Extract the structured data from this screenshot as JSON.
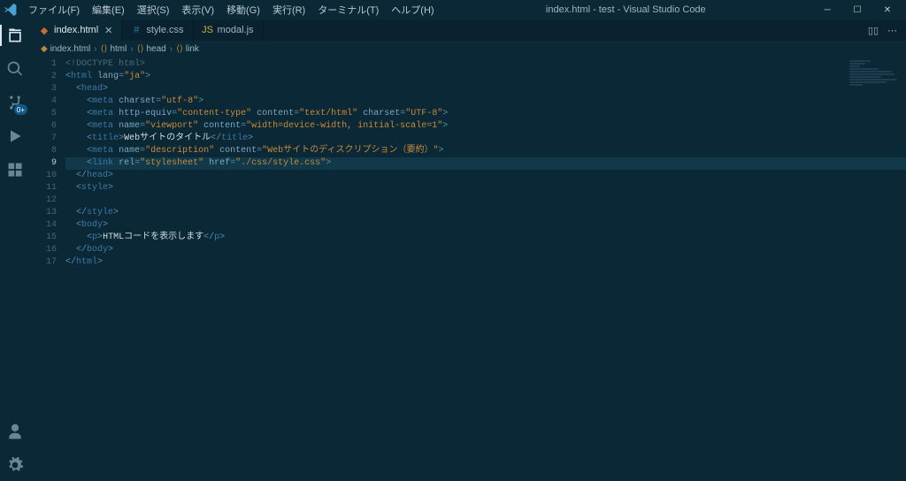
{
  "window": {
    "title": "index.html - test - Visual Studio Code"
  },
  "menu": {
    "items": [
      "ファイル(F)",
      "編集(E)",
      "選択(S)",
      "表示(V)",
      "移動(G)",
      "実行(R)",
      "ターミナル(T)",
      "ヘルプ(H)"
    ]
  },
  "winControls": {
    "min": "─",
    "max": "☐",
    "close": "✕"
  },
  "activity": {
    "badge_scm": "0+"
  },
  "tabs": [
    {
      "label": "index.html",
      "icon": "html-file-icon",
      "active": true,
      "dirty": false
    },
    {
      "label": "style.css",
      "icon": "css-file-icon",
      "active": false,
      "dirty": false
    },
    {
      "label": "modal.js",
      "icon": "js-file-icon",
      "active": false,
      "dirty": false
    }
  ],
  "tabActions": {
    "split": "▯▯",
    "more": "⋯"
  },
  "breadcrumbs": [
    {
      "icon": "html-file-icon",
      "label": "index.html"
    },
    {
      "icon": "tag-icon",
      "label": "html"
    },
    {
      "icon": "tag-icon",
      "label": "head"
    },
    {
      "icon": "tag-icon",
      "label": "link"
    }
  ],
  "code": {
    "lineCount": 17,
    "currentLine": 9,
    "lines": [
      {
        "n": 1,
        "html": "<span class='t-comment'>&lt;!DOCTYPE html&gt;</span>"
      },
      {
        "n": 2,
        "html": "<span class='t-punct'>&lt;</span><span class='t-tag'>html</span> <span class='t-attr'>lang</span><span class='t-punct'>=</span><span class='t-string'>\"ja\"</span><span class='t-punct'>&gt;</span>"
      },
      {
        "n": 3,
        "html": "  <span class='t-punct'>&lt;</span><span class='t-tag'>head</span><span class='t-punct'>&gt;</span>"
      },
      {
        "n": 4,
        "html": "    <span class='t-punct'>&lt;</span><span class='t-tag'>meta</span> <span class='t-attr'>charset</span><span class='t-punct'>=</span><span class='t-string'>\"utf-8\"</span><span class='t-punct'>&gt;</span>"
      },
      {
        "n": 5,
        "html": "    <span class='t-punct'>&lt;</span><span class='t-tag'>meta</span> <span class='t-attr'>http-equiv</span><span class='t-punct'>=</span><span class='t-string'>\"content-type\"</span> <span class='t-attr'>content</span><span class='t-punct'>=</span><span class='t-string'>\"text/html\"</span> <span class='t-attr'>charset</span><span class='t-punct'>=</span><span class='t-string'>\"UTF-8\"</span><span class='t-punct'>&gt;</span>"
      },
      {
        "n": 6,
        "html": "    <span class='t-punct'>&lt;</span><span class='t-tag'>meta</span> <span class='t-attr'>name</span><span class='t-punct'>=</span><span class='t-string'>\"viewport\"</span> <span class='t-attr'>content</span><span class='t-punct'>=</span><span class='t-string'>\"width=device-width, initial-scale=1\"</span><span class='t-punct'>&gt;</span>"
      },
      {
        "n": 7,
        "html": "    <span class='t-punct'>&lt;</span><span class='t-tag'>title</span><span class='t-punct'>&gt;</span><span class='t-text'>Webサイトのタイトル</span><span class='t-punct'>&lt;/</span><span class='t-tag'>title</span><span class='t-punct'>&gt;</span>"
      },
      {
        "n": 8,
        "html": "    <span class='t-punct'>&lt;</span><span class='t-tag'>meta</span> <span class='t-attr'>name</span><span class='t-punct'>=</span><span class='t-string'>\"description\"</span> <span class='t-attr'>content</span><span class='t-punct'>=</span><span class='t-string'>\"Webサイトのディスクリプション（要約）\"</span><span class='t-punct'>&gt;</span>"
      },
      {
        "n": 9,
        "html": "    <span class='t-punct'>&lt;</span><span class='t-tag'>link</span> <span class='t-attr'>rel</span><span class='t-punct'>=</span><span class='t-string'>\"stylesheet\"</span> <span class='t-attr'>href</span><span class='t-punct'>=</span><span class='t-string'>\"./css/style.css\"</span><span class='t-punct'>&gt;</span>"
      },
      {
        "n": 10,
        "html": "  <span class='t-punct'>&lt;/</span><span class='t-tag'>head</span><span class='t-punct'>&gt;</span>"
      },
      {
        "n": 11,
        "html": "  <span class='t-punct'>&lt;</span><span class='t-tag'>style</span><span class='t-punct'>&gt;</span>"
      },
      {
        "n": 12,
        "html": ""
      },
      {
        "n": 13,
        "html": "  <span class='t-punct'>&lt;/</span><span class='t-tag'>style</span><span class='t-punct'>&gt;</span>"
      },
      {
        "n": 14,
        "html": "  <span class='t-punct'>&lt;</span><span class='t-tag'>body</span><span class='t-punct'>&gt;</span>"
      },
      {
        "n": 15,
        "html": "    <span class='t-punct'>&lt;</span><span class='t-tag'>p</span><span class='t-punct'>&gt;</span><span class='t-text'>HTMLコードを表示します</span><span class='t-punct'>&lt;/</span><span class='t-tag'>p</span><span class='t-punct'>&gt;</span>"
      },
      {
        "n": 16,
        "html": "  <span class='t-punct'>&lt;/</span><span class='t-tag'>body</span><span class='t-punct'>&gt;</span>"
      },
      {
        "n": 17,
        "html": "<span class='t-punct'>&lt;/</span><span class='t-tag'>html</span><span class='t-punct'>&gt;</span>"
      }
    ]
  }
}
